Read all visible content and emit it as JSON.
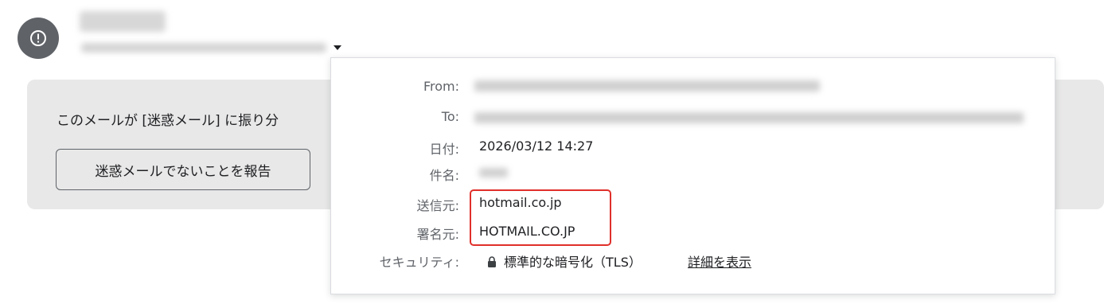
{
  "sender": {
    "avatar_icon": "alert-circle-icon",
    "dropdown_icon": "caret-down-icon"
  },
  "spam_banner": {
    "message": "このメールが [迷惑メール] に振り分",
    "not_spam_button": "迷惑メールでないことを報告"
  },
  "details_popup": {
    "rows": [
      {
        "label": "From:",
        "value": ""
      },
      {
        "label": "To:",
        "value": ""
      },
      {
        "label": "日付:",
        "value": "2026/03/12 14:27"
      },
      {
        "label": "件名:",
        "value": ""
      },
      {
        "label": "送信元:",
        "value": "hotmail.co.jp"
      },
      {
        "label": "署名元:",
        "value": "HOTMAIL.CO.JP"
      },
      {
        "label": "セキュリティ:",
        "value": "標準的な暗号化（TLS）"
      }
    ],
    "security_icon": "lock-icon",
    "details_link": "詳細を表示",
    "highlight_color": "#e0302b"
  }
}
